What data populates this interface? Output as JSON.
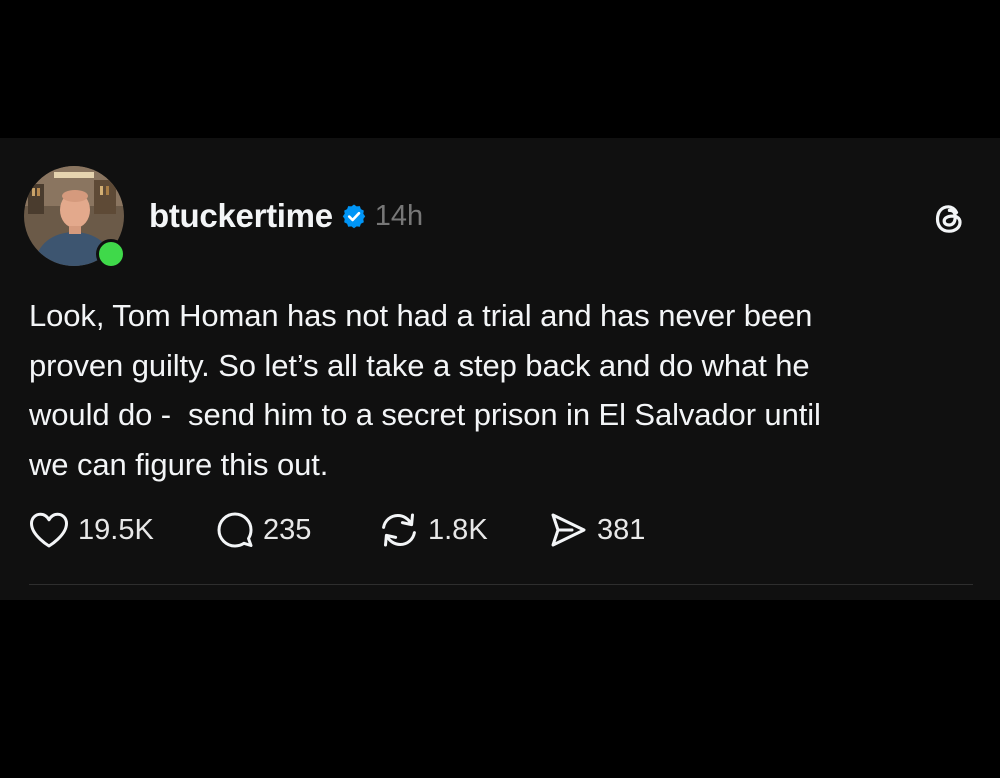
{
  "post": {
    "author": {
      "username": "btuckertime",
      "verified": true,
      "online": true
    },
    "timestamp": "14h",
    "text": "Look, Tom Homan has not had a trial and has never been\nproven guilty. So let’s all take a step back and do what he\nwould do -  send him to a secret prison in El Salvador until\nwe can figure this out.",
    "actions": {
      "likes": "19.5K",
      "replies": "235",
      "reposts": "1.8K",
      "shares": "381"
    }
  },
  "icons": {
    "verified": "verified-badge-icon",
    "app": "threads-logo-icon",
    "like": "heart-icon",
    "reply": "speech-bubble-icon",
    "repost": "repost-icon",
    "share": "send-icon"
  },
  "colors": {
    "background": "#000000",
    "card": "#101010",
    "text": "#f3f5f7",
    "muted": "#777777",
    "verified_blue": "#0095f6",
    "online_green": "#3fd94a"
  }
}
